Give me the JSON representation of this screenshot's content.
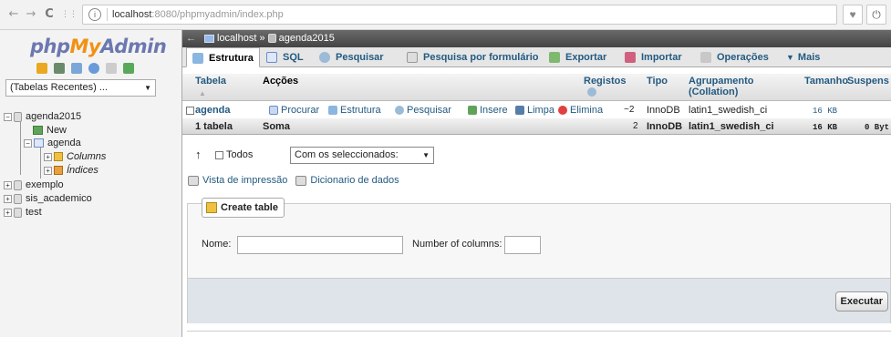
{
  "browser": {
    "url_host": "localhost",
    "url_rest": ":8080/phpmyadmin/index.php",
    "back": "←",
    "forward": "→",
    "reload": "C",
    "apps": "⋮⋮",
    "info": "i"
  },
  "logo": {
    "php": "php",
    "my": "My",
    "admin": "Admin"
  },
  "recent_select": "(Tabelas Recentes) ...",
  "tree": {
    "db1": "agenda2015",
    "new": "New",
    "table": "agenda",
    "columns": "Columns",
    "indices": "Índices",
    "db2": "exemplo",
    "db3": "sis_academico",
    "db4": "test"
  },
  "breadcrumb": {
    "server": "localhost",
    "sep": "»",
    "db": "agenda2015",
    "back": "←"
  },
  "tabs": [
    "Estrutura",
    "SQL",
    "Pesquisar",
    "Pesquisa por formulário",
    "Exportar",
    "Importar",
    "Operações",
    "Mais"
  ],
  "tabs_more_arrow": "▼",
  "table_headers": {
    "tabela": "Tabela",
    "accoes": "Acções",
    "registos": "Registos",
    "tipo": "Tipo",
    "agrupamento1": "Agrupamento",
    "agrupamento2": "(Collation)",
    "tamanho": "Tamanho",
    "suspenso": "Suspens"
  },
  "row": {
    "name": "agenda",
    "actions": [
      "Procurar",
      "Estrutura",
      "Pesquisar",
      "Insere",
      "Limpa",
      "Elimina"
    ],
    "registos": "~2",
    "tipo": "InnoDB",
    "collation": "latin1_swedish_ci",
    "tamanho": "16 KB"
  },
  "summary": {
    "count": "1 tabela",
    "soma": "Soma",
    "registos": "2",
    "tipo": "InnoDB",
    "collation": "latin1_swedish_ci",
    "tamanho": "16 KB",
    "suspenso": "0 Byt"
  },
  "bulk": {
    "arrow": "↑",
    "todos": "Todos",
    "select": "Com os seleccionados:"
  },
  "links": {
    "print": "Vista de impressão",
    "dict": "Dicionario de dados"
  },
  "create": {
    "button": "Create table",
    "name_label": "Nome:",
    "cols_label": "Number of columns:",
    "execute": "Executar"
  },
  "colors": {
    "link": "#235a81",
    "crumb_bg": "#555555",
    "footer_bg": "#dfe4ea"
  }
}
